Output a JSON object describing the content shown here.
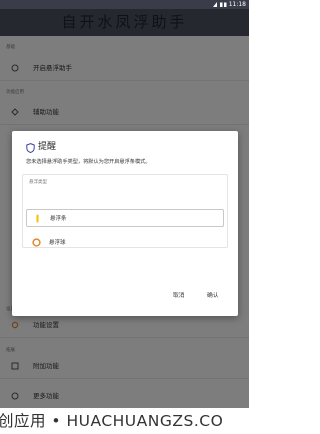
{
  "status_bar": {
    "time": "11:18"
  },
  "banner": {
    "title": "自开水凤浮助手"
  },
  "background": {
    "sections": [
      {
        "label": "基础"
      },
      {
        "label": "功能启用"
      }
    ],
    "rows": [
      {
        "label": "开启悬浮助手"
      },
      {
        "label": "辅助功能"
      },
      {
        "label": "功能设置"
      },
      {
        "label": "附加功能"
      },
      {
        "label": "更多功能"
      }
    ],
    "section_labels_lower": [
      "设置",
      "拓展"
    ]
  },
  "dialog": {
    "title": "提醒",
    "message": "您未选择悬浮助手类型，将默认为您开启悬浮条模式。",
    "group_label": "悬浮类型",
    "options": [
      {
        "label": "悬浮条",
        "selected": true
      },
      {
        "label": "悬浮球",
        "selected": false
      }
    ],
    "cancel_label": "取消",
    "confirm_label": "确认"
  },
  "watermark": {
    "text": "创应用 • HUACHUANGZS.CO"
  },
  "colors": {
    "status_bar": "#3a3c4a",
    "banner": "#4d5160",
    "accent_yellow": "#f2c200",
    "accent_orange": "#e08a2c"
  }
}
